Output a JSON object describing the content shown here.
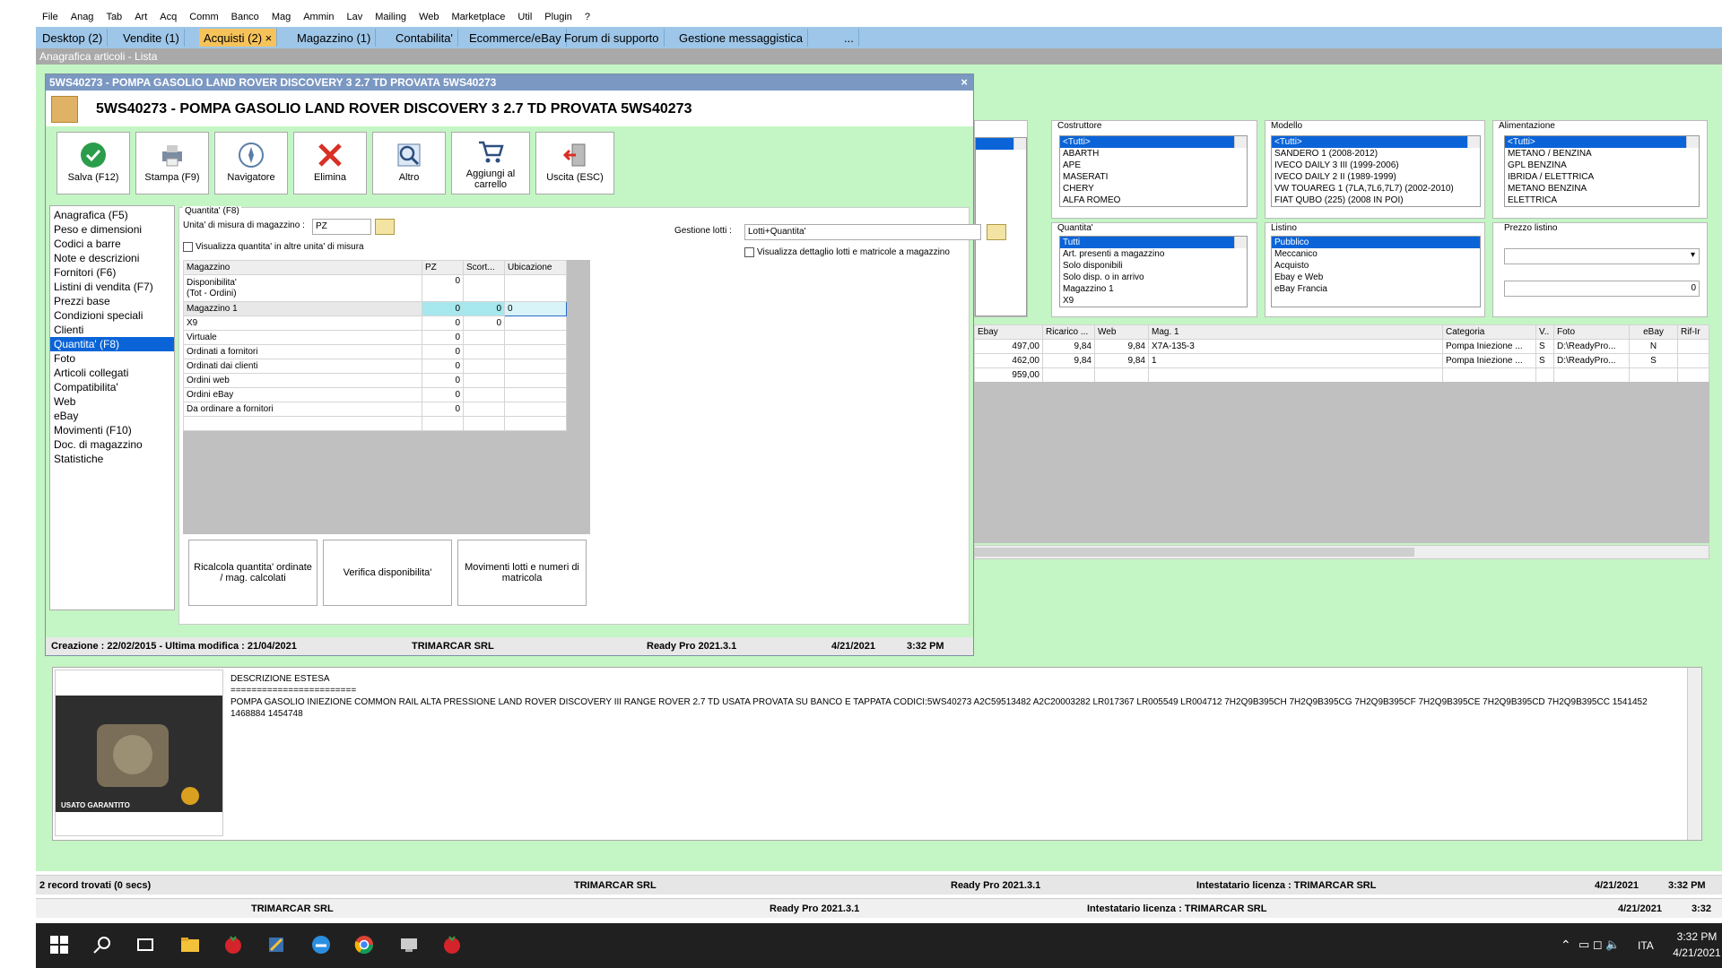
{
  "menubar": {
    "items": [
      "File",
      "Anag",
      "Tab",
      "Art",
      "Acq",
      "Comm",
      "Banco",
      "Mag",
      "Ammin",
      "Lav",
      "Mailing",
      "Web",
      "Marketplace",
      "Util",
      "Plugin",
      "?"
    ]
  },
  "tabs": [
    {
      "label": "Desktop (2)"
    },
    {
      "label": "Vendite (1)"
    },
    {
      "label": "Acquisti (2)",
      "close": "×"
    },
    {
      "label": "Magazzino (1)"
    },
    {
      "label": "Contabilita'"
    },
    {
      "label": "Ecommerce/eBay"
    },
    {
      "label": "Forum di supporto"
    },
    {
      "label": "Gestione messaggistica"
    },
    {
      "label": "..."
    }
  ],
  "subtitle": "Anagrafica articoli  - Lista",
  "filters": {
    "costruttore": {
      "label": "Costruttore",
      "items": [
        "<Tutti>",
        "ABARTH",
        "APE",
        "MASERATI",
        "CHERY",
        "ALFA ROMEO"
      ]
    },
    "modello": {
      "label": "Modello",
      "items": [
        "<Tutti>",
        "SANDERO 1 (2008-2012)",
        "IVECO DAILY 3 III (1999-2006)",
        "IVECO DAILY 2 II (1989-1999)",
        "VW TOUAREG 1 (7LA,7L6,7L7) (2002-2010)",
        "FIAT QUBO (225) (2008 IN POI)"
      ]
    },
    "alimentazione": {
      "label": "Alimentazione",
      "items": [
        "<Tutti>",
        "METANO / BENZINA",
        "GPL BENZINA",
        "IBRIDA / ELETTRICA",
        "METANO BENZINA",
        "ELETTRICA"
      ]
    },
    "quantita": {
      "label": "Quantita'",
      "items": [
        "Tutti",
        "Art. presenti a magazzino",
        "Solo disponibili",
        "Solo disp. o in arrivo",
        "Magazzino 1",
        "X9"
      ]
    },
    "listino": {
      "label": "Listino",
      "items": [
        "Pubblico",
        "Meccanico",
        "Acquisto",
        "Ebay e Web",
        "eBay Francia"
      ]
    },
    "prezzo_listino": {
      "label": "Prezzo listino",
      "value": "0"
    }
  },
  "list_table": {
    "headers": [
      "Ebay",
      "Ricarico ...",
      "Web",
      "Mag. 1",
      "Categoria",
      "V..",
      "Foto",
      "eBay",
      "Rif-Ir"
    ],
    "rows": [
      [
        "497,00",
        "9,84",
        "9,84",
        "X7A-135-3",
        "Pompa Iniezione ...",
        "S",
        "D:\\ReadyPro...",
        "N",
        ""
      ],
      [
        "462,00",
        "9,84",
        "9,84",
        "1",
        "Pompa Iniezione ...",
        "S",
        "D:\\ReadyPro...",
        "S",
        ""
      ],
      [
        "959,00",
        "",
        "",
        "",
        "",
        "",
        "",
        "",
        ""
      ]
    ]
  },
  "dialog": {
    "titlebar": "5WS40273 - POMPA GASOLIO LAND ROVER DISCOVERY 3 2.7 TD PROVATA 5WS40273",
    "close": "×",
    "header_title": "5WS40273 - POMPA GASOLIO LAND ROVER DISCOVERY 3 2.7 TD PROVATA 5WS40273",
    "toolbar": [
      {
        "label": "Salva (F12)"
      },
      {
        "label": "Stampa (F9)"
      },
      {
        "label": "Navigatore"
      },
      {
        "label": "Elimina"
      },
      {
        "label": "Altro"
      },
      {
        "label": "Aggiungi al carrello"
      },
      {
        "label": "Uscita (ESC)"
      }
    ],
    "nav": [
      "Anagrafica (F5)",
      "Peso e dimensioni",
      "Codici a barre",
      "Note e descrizioni",
      "Fornitori (F6)",
      "Listini di vendita (F7)",
      "Prezzi base",
      "Condizioni speciali",
      "Clienti",
      "Quantita' (F8)",
      "Foto",
      "Articoli collegati",
      "Compatibilita'",
      "Web",
      "eBay",
      "Movimenti (F10)",
      "Doc. di magazzino",
      "Statistiche"
    ],
    "quantita": {
      "section_label": "Quantita' (F8)",
      "um_label": "Unita' di misura di magazzino :",
      "um_value": "PZ",
      "altre_um_label": "Visualizza quantita' in altre unita' di misura",
      "lotti_label": "Gestione lotti :",
      "lotti_value": "Lotti+Quantita'",
      "dettaglio_lotti_label": "Visualizza dettaglio lotti e matricole a magazzino",
      "table_headers": [
        "Magazzino",
        "PZ",
        "Scort...",
        "Ubicazione"
      ],
      "rows": [
        {
          "name": "Disponibilita'\n(Tot - Ordini)",
          "pz": "0",
          "scorta": "",
          "ubic": ""
        },
        {
          "name": "Magazzino 1",
          "pz": "0",
          "scorta": "0",
          "ubic": "0"
        },
        {
          "name": "X9",
          "pz": "0",
          "scorta": "0",
          "ubic": ""
        },
        {
          "name": "Virtuale",
          "pz": "0",
          "scorta": "",
          "ubic": ""
        },
        {
          "name": "Ordinati a fornitori",
          "pz": "0",
          "scorta": "",
          "ubic": ""
        },
        {
          "name": "Ordinati dai clienti",
          "pz": "0",
          "scorta": "",
          "ubic": ""
        },
        {
          "name": "Ordini web",
          "pz": "0",
          "scorta": "",
          "ubic": ""
        },
        {
          "name": "Ordini eBay",
          "pz": "0",
          "scorta": "",
          "ubic": ""
        },
        {
          "name": "Da ordinare a fornitori",
          "pz": "0",
          "scorta": "",
          "ubic": ""
        }
      ],
      "buttons": [
        "Ricalcola quantita' ordinate / mag. calcolati",
        "Verifica disponibilita'",
        "Movimenti lotti e numeri di matricola"
      ]
    },
    "status": {
      "dates": "Creazione : 22/02/2015 - Ultima modifica : 21/04/2021",
      "company": "TRIMARCAR SRL",
      "version": "Ready Pro 2021.3.1",
      "date": "4/21/2021",
      "time": "3:32 PM"
    }
  },
  "description": {
    "title": "DESCRIZIONE ESTESA",
    "separator": "========================",
    "text": "POMPA GASOLIO INIEZIONE COMMON RAIL ALTA PRESSIONE LAND ROVER DISCOVERY III RANGE ROVER 2.7 TD USATA PROVATA SU BANCO E TAPPATA CODICI:5WS40273 A2C59513482 A2C20003282 LR017367 LR005549 LR004712 7H2Q9B395CH 7H2Q9B395CG 7H2Q9B395CF 7H2Q9B395CE 7H2Q9B395CD 7H2Q9B395CC 1541452 1468884 1454748",
    "photo_caption": "USATO GARANTITO"
  },
  "status1": {
    "records": "2 record trovati (0 secs)",
    "company": "TRIMARCAR SRL",
    "version": "Ready Pro 2021.3.1",
    "licensee": "Intestatario licenza : TRIMARCAR SRL",
    "date": "4/21/2021",
    "time": "3:32 PM"
  },
  "status2": {
    "company": "TRIMARCAR SRL",
    "version": "Ready Pro 2021.3.1",
    "licensee": "Intestatario licenza : TRIMARCAR SRL",
    "date": "4/21/2021",
    "time": "3:32"
  },
  "taskbar": {
    "lang": "ITA",
    "time": "3:32 PM",
    "date": "4/21/2021"
  }
}
